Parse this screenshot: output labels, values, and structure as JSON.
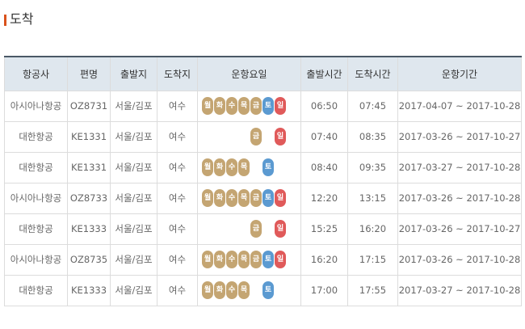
{
  "page": {
    "title": "도착"
  },
  "colors": {
    "weekday": "#c4a572",
    "saturday": "#5b9ad1",
    "sunday": "#e05a5a",
    "header_bg": "#dfe7ee"
  },
  "table": {
    "headers": [
      "항공사",
      "편명",
      "출발지",
      "도착지",
      "운항요일",
      "출발시간",
      "도착시간",
      "운항기간"
    ],
    "day_labels": [
      "월",
      "화",
      "수",
      "목",
      "금",
      "토",
      "일"
    ],
    "rows": [
      {
        "airline": "아시아나항공",
        "flight": "OZ8731",
        "from": "서울/김포",
        "to": "여수",
        "days": [
          1,
          1,
          1,
          1,
          1,
          1,
          1
        ],
        "dep": "06:50",
        "arr": "07:45",
        "period": "2017-04-07 ~ 2017-10-28"
      },
      {
        "airline": "대한항공",
        "flight": "KE1331",
        "from": "서울/김포",
        "to": "여수",
        "days": [
          0,
          0,
          0,
          0,
          1,
          0,
          1
        ],
        "dep": "07:40",
        "arr": "08:35",
        "period": "2017-03-26 ~ 2017-10-27"
      },
      {
        "airline": "대한항공",
        "flight": "KE1331",
        "from": "서울/김포",
        "to": "여수",
        "days": [
          1,
          1,
          1,
          1,
          0,
          1,
          0
        ],
        "dep": "08:40",
        "arr": "09:35",
        "period": "2017-03-27 ~ 2017-10-28"
      },
      {
        "airline": "아시아나항공",
        "flight": "OZ8733",
        "from": "서울/김포",
        "to": "여수",
        "days": [
          1,
          1,
          1,
          1,
          1,
          1,
          1
        ],
        "dep": "12:20",
        "arr": "13:15",
        "period": "2017-03-26 ~ 2017-10-28"
      },
      {
        "airline": "대한항공",
        "flight": "KE1333",
        "from": "서울/김포",
        "to": "여수",
        "days": [
          0,
          0,
          0,
          0,
          1,
          0,
          1
        ],
        "dep": "15:25",
        "arr": "16:20",
        "period": "2017-03-26 ~ 2017-10-27"
      },
      {
        "airline": "아시아나항공",
        "flight": "OZ8735",
        "from": "서울/김포",
        "to": "여수",
        "days": [
          1,
          1,
          1,
          1,
          1,
          1,
          1
        ],
        "dep": "16:20",
        "arr": "17:15",
        "period": "2017-03-26 ~ 2017-10-28"
      },
      {
        "airline": "대한항공",
        "flight": "KE1333",
        "from": "서울/김포",
        "to": "여수",
        "days": [
          1,
          1,
          1,
          1,
          0,
          1,
          0
        ],
        "dep": "17:00",
        "arr": "17:55",
        "period": "2017-03-27 ~ 2017-10-28"
      }
    ]
  }
}
